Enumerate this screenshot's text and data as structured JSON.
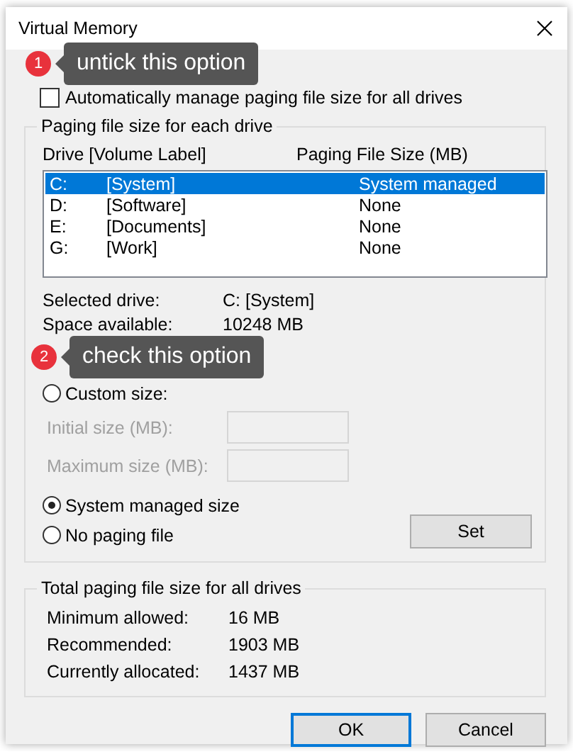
{
  "window": {
    "title": "Virtual Memory"
  },
  "auto_manage": {
    "label": "Automatically manage paging file size for all drives",
    "checked": false,
    "callout": {
      "number": "1",
      "text": "untick this option"
    }
  },
  "drives_group": {
    "title": "Paging file size for each drive",
    "columns": [
      "Drive  [Volume Label]",
      "Paging File Size (MB)"
    ],
    "rows": [
      {
        "drive": "C:",
        "label": "[System]",
        "size": "System managed",
        "selected": true
      },
      {
        "drive": "D:",
        "label": "[Software]",
        "size": "None",
        "selected": false
      },
      {
        "drive": "E:",
        "label": "[Documents]",
        "size": "None",
        "selected": false
      },
      {
        "drive": "G:",
        "label": "[Work]",
        "size": "None",
        "selected": false
      }
    ],
    "info": [
      {
        "label": "Selected drive:",
        "value": "C:  [System]"
      },
      {
        "label": "Space available:",
        "value": "10248 MB"
      }
    ],
    "size_options": [
      {
        "label": "Custom size:",
        "selected": false,
        "callout": {
          "number": "2",
          "text": "check this option"
        }
      },
      {
        "label": "System managed size",
        "selected": true
      },
      {
        "label": "No paging file",
        "selected": false
      }
    ],
    "custom_fields": [
      {
        "label": "Initial size (MB):",
        "disabled": true
      },
      {
        "label": "Maximum size (MB):",
        "disabled": true
      }
    ],
    "set_button": "Set"
  },
  "totals_group": {
    "title": "Total paging file size for all drives",
    "rows": [
      {
        "label": "Minimum allowed:",
        "value": "16 MB"
      },
      {
        "label": "Recommended:",
        "value": "1903 MB"
      },
      {
        "label": "Currently allocated:",
        "value": "1437 MB"
      }
    ]
  },
  "buttons": [
    {
      "label": "OK",
      "default": true
    },
    {
      "label": "Cancel",
      "default": false
    }
  ]
}
